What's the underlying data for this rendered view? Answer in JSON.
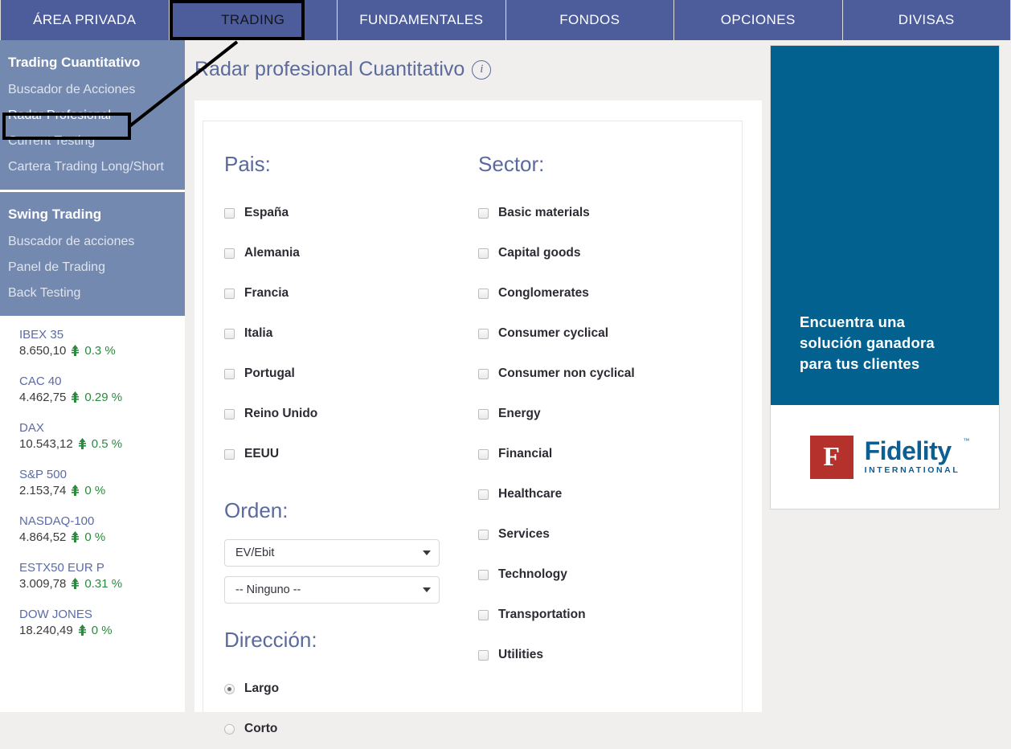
{
  "nav": {
    "items": [
      {
        "label": "ÁREA PRIVADA",
        "highlighted": false
      },
      {
        "label": "TRADING",
        "highlighted": true
      },
      {
        "label": "FUNDAMENTALES",
        "highlighted": false
      },
      {
        "label": "FONDOS",
        "highlighted": false
      },
      {
        "label": "OPCIONES",
        "highlighted": false
      },
      {
        "label": "DIVISAS",
        "highlighted": false
      }
    ]
  },
  "sidebar": {
    "groups": [
      {
        "heading": "Trading Cuantitativo",
        "links": [
          "Buscador de Acciones",
          "Radar Profesional",
          "Current Testing",
          "Cartera Trading Long/Short"
        ],
        "active_link": "Radar Profesional"
      },
      {
        "heading": "Swing Trading",
        "links": [
          "Buscador de acciones",
          "Panel de Trading",
          "Back Testing"
        ],
        "active_link": ""
      }
    ],
    "quotes": [
      {
        "name": "IBEX 35",
        "value": "8.650,10",
        "change": "0.3 %",
        "direction": "up"
      },
      {
        "name": "CAC 40",
        "value": "4.462,75",
        "change": "0.29 %",
        "direction": "up"
      },
      {
        "name": "DAX",
        "value": "10.543,12",
        "change": "0.5 %",
        "direction": "up"
      },
      {
        "name": "S&P 500",
        "value": "2.153,74",
        "change": "0 %",
        "direction": "up"
      },
      {
        "name": "NASDAQ-100",
        "value": "4.864,52",
        "change": "0 %",
        "direction": "up"
      },
      {
        "name": "ESTX50 EUR P",
        "value": "3.009,78",
        "change": "0.31 %",
        "direction": "up"
      },
      {
        "name": "DOW JONES",
        "value": "18.240,49",
        "change": "0 %",
        "direction": "up"
      }
    ]
  },
  "page": {
    "title": "Radar profesional Cuantitativo",
    "info_icon": "info-icon",
    "info_glyph": "i"
  },
  "filters": {
    "pais": {
      "title": "Pais:",
      "options": [
        {
          "label": "España",
          "checked": false
        },
        {
          "label": "Alemania",
          "checked": false
        },
        {
          "label": "Francia",
          "checked": false
        },
        {
          "label": "Italia",
          "checked": false
        },
        {
          "label": "Portugal",
          "checked": false
        },
        {
          "label": "Reino Unido",
          "checked": false
        },
        {
          "label": "EEUU",
          "checked": false
        }
      ]
    },
    "sector": {
      "title": "Sector:",
      "options": [
        {
          "label": "Basic materials",
          "checked": false
        },
        {
          "label": "Capital goods",
          "checked": false
        },
        {
          "label": "Conglomerates",
          "checked": false
        },
        {
          "label": "Consumer cyclical",
          "checked": false
        },
        {
          "label": "Consumer non cyclical",
          "checked": false
        },
        {
          "label": "Energy",
          "checked": false
        },
        {
          "label": "Financial",
          "checked": false
        },
        {
          "label": "Healthcare",
          "checked": false
        },
        {
          "label": "Services",
          "checked": false
        },
        {
          "label": "Technology",
          "checked": false
        },
        {
          "label": "Transportation",
          "checked": false
        },
        {
          "label": "Utilities",
          "checked": false
        }
      ]
    },
    "orden": {
      "title": "Orden:",
      "select_primary": "EV/Ebit",
      "select_secondary": "-- Ninguno --"
    },
    "direccion": {
      "title": "Dirección:",
      "options": [
        {
          "label": "Largo",
          "selected": true
        },
        {
          "label": "Corto",
          "selected": false
        }
      ]
    }
  },
  "ad": {
    "headline_line1": "Encuentra una",
    "headline_line2": "solución ganadora",
    "headline_line3": "para tus clientes",
    "brand_mark": "F",
    "brand_name": "Fidelity",
    "brand_sub": "INTERNATIONAL",
    "brand_tm": "™"
  },
  "colors": {
    "nav_blue": "#4d5c9b",
    "sidebar_blue": "#7389b0",
    "accent_title": "#5a6a9e",
    "quote_green": "#2a8a3e",
    "ad_blue": "#03618f",
    "logo_red": "#b5312c",
    "logo_blue": "#0d5e92"
  }
}
